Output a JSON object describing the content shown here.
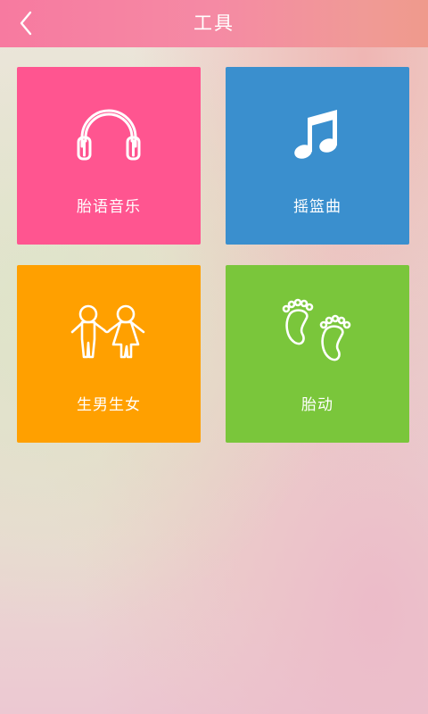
{
  "header": {
    "title": "工具",
    "back_icon": "chevron-left-icon",
    "background": "#f77aa0"
  },
  "tools": [
    {
      "label": "胎语音乐",
      "icon": "headphones-icon",
      "color": "#ff5590"
    },
    {
      "label": "摇篮曲",
      "icon": "music-note-icon",
      "color": "#3a8fce"
    },
    {
      "label": "生男生女",
      "icon": "boy-girl-icon",
      "color": "#ffa000"
    },
    {
      "label": "胎动",
      "icon": "footprints-icon",
      "color": "#7ac63b"
    }
  ]
}
